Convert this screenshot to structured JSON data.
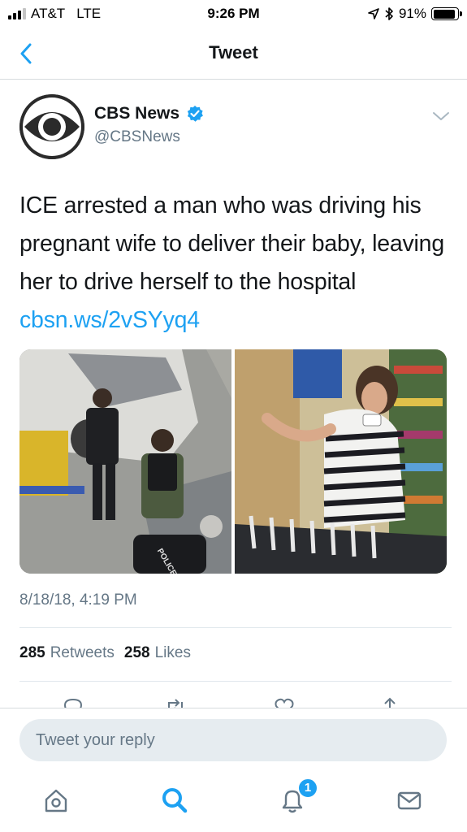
{
  "status_bar": {
    "carrier": "AT&T",
    "network": "LTE",
    "time": "9:26 PM",
    "battery": "91%",
    "battery_level": 0.91
  },
  "nav": {
    "title": "Tweet",
    "back_icon": "chevron-left-icon"
  },
  "tweet": {
    "author_name": "CBS News",
    "author_handle": "@CBSNews",
    "text": "ICE arrested a man who was driving his pregnant wife to deliver their baby, leaving her to drive herself to the hospital ",
    "link": "cbsn.ws/2vSYyq4",
    "timestamp": "8/18/18, 4:19 PM",
    "media_labels": [
      "POLICE"
    ]
  },
  "stats": {
    "retweets_count": "285",
    "retweets_label": "Retweets",
    "likes_count": "258",
    "likes_label": "Likes"
  },
  "reply": {
    "placeholder": "Tweet your reply"
  },
  "tab_bar": {
    "items": [
      "home-icon",
      "search-icon",
      "notifications-icon",
      "messages-icon"
    ],
    "notification_badge": "1"
  },
  "colors": {
    "accent": "#1da1f2",
    "text_primary": "#14171a",
    "text_secondary": "#657786",
    "divider": "#e1e8ed",
    "input_bg": "#e6ecf0"
  }
}
